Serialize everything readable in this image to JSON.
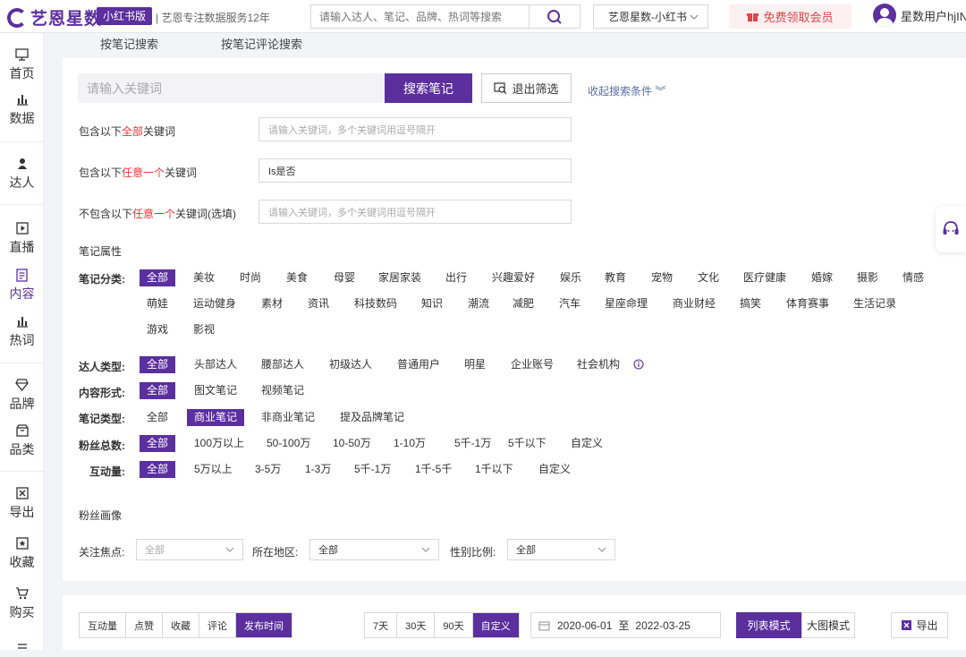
{
  "header": {
    "logo_text": "艺恩星数",
    "edition_badge": "小红书版",
    "tagline": "| 艺恩专注数据服务12年",
    "search_placeholder": "请输入达人、笔记、品牌、热词等搜索",
    "platform": "艺恩星数-小红书",
    "vip_label": "免费领取会员",
    "user_name": "星数用户hjIN"
  },
  "sidebar": {
    "items": [
      {
        "label": "首页",
        "icon": "monitor-icon"
      },
      {
        "label": "数据",
        "icon": "bar-chart-icon"
      },
      {
        "label": "达人",
        "icon": "person-icon"
      },
      {
        "label": "直播",
        "icon": "play-icon"
      },
      {
        "label": "内容",
        "icon": "document-icon"
      },
      {
        "label": "热词",
        "icon": "bar-chart-icon"
      },
      {
        "label": "品牌",
        "icon": "diamond-icon"
      },
      {
        "label": "品类",
        "icon": "box-icon"
      },
      {
        "label": "导出",
        "icon": "excel-icon"
      },
      {
        "label": "收藏",
        "icon": "star-icon"
      },
      {
        "label": "购买",
        "icon": "cart-icon"
      }
    ]
  },
  "subtabs": [
    "按笔记搜索",
    "按笔记评论搜索"
  ],
  "search": {
    "keyword_placeholder": "请输入关键词",
    "search_button": "搜索笔记",
    "exit_filter": "退出筛选",
    "collapse": "收起搜索条件"
  },
  "keyword_rows": [
    {
      "prefix": "包含以下",
      "highlight": "全部",
      "suffix": "关键词",
      "placeholder": "请输入关键词，多个关键词用逗号隔开",
      "value": ""
    },
    {
      "prefix": "包含以下",
      "highlight": "任意一个",
      "suffix": "关键词",
      "placeholder": "",
      "value": "Is是否"
    },
    {
      "prefix": "不包含以下",
      "highlight": "任意一个",
      "suffix": "关键词(选填)",
      "placeholder": "请输入关键词，多个关键词用逗号隔开",
      "value": ""
    }
  ],
  "note_attr_title": "笔记属性",
  "category": {
    "label": "笔记分类:",
    "options": [
      "全部",
      "美妆",
      "时尚",
      "美食",
      "母婴",
      "家居家装",
      "出行",
      "兴趣爱好",
      "娱乐",
      "教育",
      "宠物",
      "文化",
      "医疗健康",
      "婚嫁",
      "摄影",
      "情感",
      "萌娃",
      "运动健身",
      "素材",
      "资讯",
      "科技数码",
      "知识",
      "潮流",
      "减肥",
      "汽车",
      "星座命理",
      "商业财经",
      "搞笑",
      "体育赛事",
      "生活记录",
      "游戏",
      "影视"
    ],
    "selected": "全部"
  },
  "influencer_type": {
    "label": "达人类型:",
    "options": [
      "全部",
      "头部达人",
      "腰部达人",
      "初级达人",
      "普通用户",
      "明星",
      "企业账号",
      "社会机构"
    ],
    "selected": "全部"
  },
  "content_form": {
    "label": "内容形式:",
    "options": [
      "全部",
      "图文笔记",
      "视频笔记"
    ],
    "selected": "全部"
  },
  "note_type": {
    "label": "笔记类型:",
    "options": [
      "全部",
      "商业笔记",
      "非商业笔记",
      "提及品牌笔记"
    ],
    "selected": "商业笔记"
  },
  "fans_total": {
    "label": "粉丝总数:",
    "options": [
      "全部",
      "100万以上",
      "50-100万",
      "10-50万",
      "1-10万",
      "5千-1万",
      "5千以下",
      "自定义"
    ],
    "selected": "全部"
  },
  "interaction": {
    "label": "互动量:",
    "options": [
      "全部",
      "5万以上",
      "3-5万",
      "1-3万",
      "5千-1万",
      "1千-5千",
      "1千以下",
      "自定义"
    ],
    "selected": "全部"
  },
  "fan_profile": {
    "title": "粉丝画像",
    "focus_label": "关注焦点:",
    "focus_value": "全部",
    "region_label": "所在地区:",
    "region_value": "全部",
    "gender_label": "性别比例:",
    "gender_value": "全部"
  },
  "bottom": {
    "sort_options": [
      "互动量",
      "点赞",
      "收藏",
      "评论",
      "发布时间"
    ],
    "sort_selected": "发布时间",
    "range_options": [
      "7天",
      "30天",
      "90天",
      "自定义"
    ],
    "range_selected": "自定义",
    "date_start": "2020-06-01",
    "date_sep": "至",
    "date_end": "2022-03-25",
    "list_mode": "列表模式",
    "grid_mode": "大图模式",
    "export": "导出"
  },
  "colors": {
    "accent": "#5b2f9e",
    "highlight": "#e33333",
    "vip": "#e0454b"
  }
}
